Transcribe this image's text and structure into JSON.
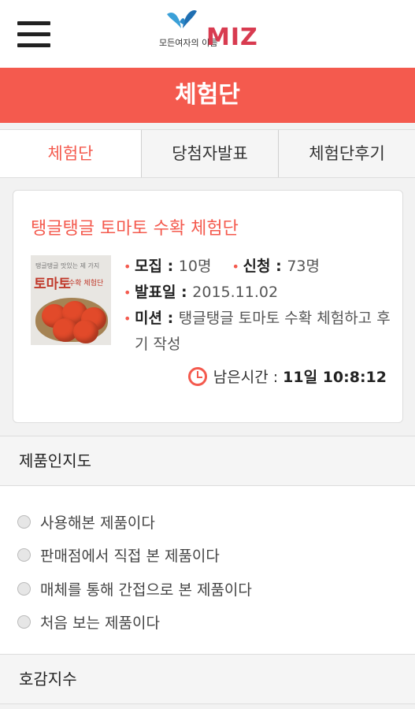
{
  "header": {
    "logo_text": "모든여자의 이름",
    "logo_brand": "MIZ"
  },
  "title": "체험단",
  "tabs": [
    {
      "label": "체험단",
      "active": true
    },
    {
      "label": "당첨자발표",
      "active": false
    },
    {
      "label": "체험단후기",
      "active": false
    }
  ],
  "card": {
    "title": "탱글탱글 토마토 수확 체험단",
    "thumbnail": {
      "small": "탱글탱글 맛있는 제 가지",
      "big": "토마토",
      "big2": "수확 체험단"
    },
    "recruit_label": "모집 : ",
    "recruit_value": "10명",
    "apply_label": "신청 : ",
    "apply_value": "73명",
    "announce_label": "발표일 : ",
    "announce_value": "2015.11.02",
    "mission_label": "미션 : ",
    "mission_value": "탱글탱글 토마토 수확 체험하고 후기 작성",
    "remaining_label": "남은시간 : ",
    "remaining_value": "11일 10:8:12"
  },
  "sections": {
    "awareness_title": "제품인지도",
    "preference_title": "호감지수"
  },
  "awareness_options": [
    "사용해본 제품이다",
    "판매점에서 직접 본 제품이다",
    "매체를 통해 간접으로 본 제품이다",
    "처음 보는 제품이다"
  ],
  "colors": {
    "accent": "#f45a4e",
    "logo_brand": "#d83b50"
  }
}
